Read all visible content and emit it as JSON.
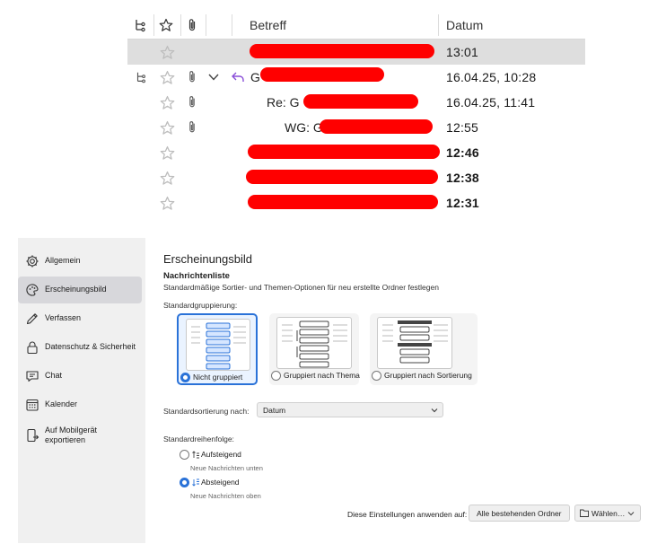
{
  "message_list": {
    "columns": {
      "subject": "Betreff",
      "date": "Datum"
    },
    "rows": [
      {
        "subject_prefix": "",
        "date": "13:01",
        "bold": false,
        "selected": true
      },
      {
        "subject_prefix": "G",
        "date": "16.04.25, 10:28",
        "bold": false,
        "selected": false
      },
      {
        "subject_prefix": "Re: G",
        "date": "16.04.25, 11:41",
        "bold": false,
        "selected": false
      },
      {
        "subject_prefix": "WG: G",
        "date": "12:55",
        "bold": false,
        "selected": false
      },
      {
        "subject_prefix": "",
        "date": "12:46",
        "bold": true,
        "selected": false
      },
      {
        "subject_prefix": "",
        "date": "12:38",
        "bold": true,
        "selected": false
      },
      {
        "subject_prefix": "",
        "date": "12:31",
        "bold": true,
        "selected": false
      }
    ]
  },
  "sidebar": {
    "items": [
      {
        "label": "Allgemein",
        "icon": "gear-icon"
      },
      {
        "label": "Erscheinungsbild",
        "icon": "brush-icon"
      },
      {
        "label": "Verfassen",
        "icon": "pencil-icon"
      },
      {
        "label": "Datenschutz & Sicherheit",
        "icon": "lock-icon"
      },
      {
        "label": "Chat",
        "icon": "chat-icon"
      },
      {
        "label": "Kalender",
        "icon": "calendar-icon"
      },
      {
        "label": "Auf Mobilgerät",
        "label2": "exportieren",
        "icon": "mobile-export-icon"
      }
    ]
  },
  "content": {
    "title": "Erscheinungsbild",
    "section": "Nachrichtenliste",
    "description": "Standardmäßige Sortier- und Themen-Optionen für neu erstellte Ordner festlegen",
    "grouping_label": "Standardgruppierung:",
    "grouping_options": [
      "Nicht gruppiert",
      "Gruppiert nach Thema",
      "Gruppiert nach Sortierung"
    ],
    "sort_label": "Standardsortierung nach:",
    "sort_value": "Datum",
    "order_label": "Standardreihenfolge:",
    "order_options": [
      {
        "label": "Aufsteigend",
        "hint": "Neue Nachrichten unten",
        "checked": false
      },
      {
        "label": "Absteigend",
        "hint": "Neue Nachrichten oben",
        "checked": true
      }
    ],
    "apply_label": "Diese Einstellungen anwenden auf:",
    "apply_all_button": "Alle bestehenden Ordner",
    "choose_button": "Wählen…"
  },
  "colors": {
    "accent": "#2a72d8",
    "redaction": "#ff0000",
    "selected_row": "#dedede",
    "sidebar_bg": "#f0f0f0"
  }
}
